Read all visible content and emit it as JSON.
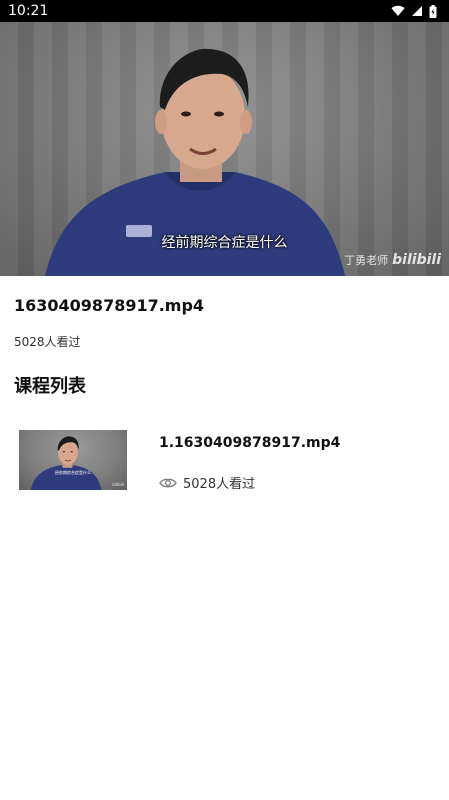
{
  "status_bar": {
    "time": "10:21"
  },
  "video": {
    "subtitle": "经前期综合症是什么",
    "watermark_author": "丁勇老师",
    "watermark_brand": "bilibili"
  },
  "info": {
    "title": "1630409878917.mp4",
    "views": "5028人看过"
  },
  "course_list": {
    "heading": "课程列表",
    "items": [
      {
        "title": "1.1630409878917.mp4",
        "views": "5028人看过",
        "thumb_caption": "经前期综合症是什么",
        "thumb_mark": "bilibili"
      }
    ]
  }
}
